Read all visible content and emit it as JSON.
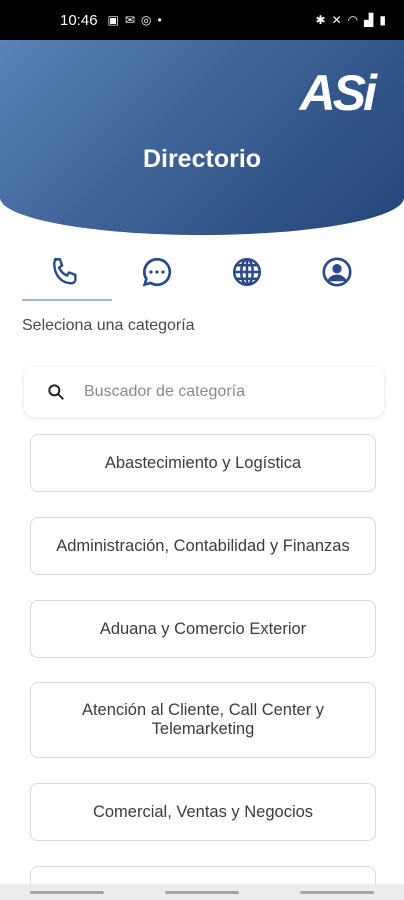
{
  "status_bar": {
    "time": "10:46"
  },
  "header": {
    "logo": "ASi",
    "title": "Directorio",
    "gradient_start": "#5a82b5",
    "gradient_end": "#234476"
  },
  "tabs": [
    {
      "icon": "phone-icon",
      "selected": true
    },
    {
      "icon": "chat-icon",
      "selected": false
    },
    {
      "icon": "globe-icon",
      "selected": false
    },
    {
      "icon": "user-icon",
      "selected": false
    }
  ],
  "accent_color": "#2b4a8a",
  "subtitle": "Seleciona una categoría",
  "search": {
    "placeholder": "Buscador de categoría"
  },
  "categories": [
    "Abastecimiento y Logística",
    "Administración, Contabilidad y Finanzas",
    "Aduana y Comercio Exterior",
    "Atención al Cliente, Call Center y Telemarketing",
    "Comercial, Ventas y Negocios",
    ""
  ]
}
